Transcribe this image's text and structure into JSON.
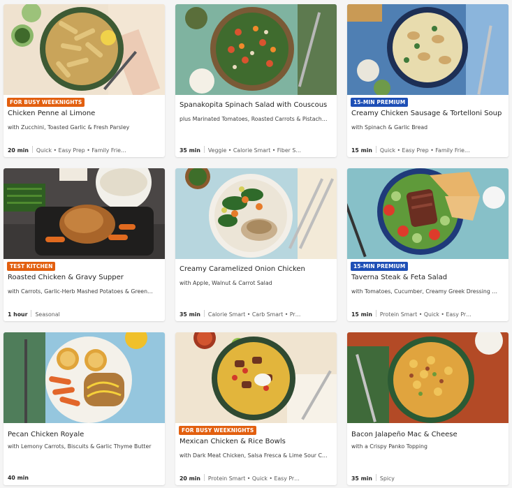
{
  "recipes": [
    {
      "title": "Chicken Penne al Limone",
      "badge": "FOR BUSY WEEKNIGHTS",
      "badge_color": "#e25f0f",
      "subtitle": "with Zucchini, Toasted Garlic & Fresh Parsley",
      "time": "20 min",
      "tags": "Quick • Easy Prep • Family Frie…"
    },
    {
      "title": "Spanakopita Spinach Salad with Couscous",
      "badge": "",
      "subtitle": "plus Marinated Tomatoes, Roasted Carrots & Pistach…",
      "time": "35 min",
      "tags": "Veggie • Calorie Smart • Fiber S…"
    },
    {
      "title": "Creamy Chicken Sausage & Tortelloni Soup",
      "badge": "15-MIN PREMIUM",
      "badge_color": "#1e4fb6",
      "subtitle": "with Spinach & Garlic Bread",
      "time": "15 min",
      "tags": "Quick • Easy Prep • Family Frie…"
    },
    {
      "title": "Roasted Chicken & Gravy Supper",
      "badge": "TEST KITCHEN",
      "badge_color": "#e25f0f",
      "subtitle": "with Carrots, Garlic-Herb Mashed Potatoes & Green…",
      "time": "1 hour",
      "tags": "Seasonal"
    },
    {
      "title": "Creamy Caramelized Onion Chicken",
      "badge": "",
      "subtitle": "with Apple, Walnut & Carrot Salad",
      "time": "35 min",
      "tags": "Calorie Smart • Carb Smart • Pr…"
    },
    {
      "title": "Taverna Steak & Feta Salad",
      "badge": "15-MIN PREMIUM",
      "badge_color": "#1e4fb6",
      "subtitle": "with Tomatoes, Cucumber, Creamy Greek Dressing …",
      "time": "15 min",
      "tags": "Protein Smart • Quick • Easy Pr…"
    },
    {
      "title": "Pecan Chicken Royale",
      "badge": "",
      "subtitle": "with Lemony Carrots, Biscuits & Garlic Thyme Butter",
      "time": "40 min",
      "tags": ""
    },
    {
      "title": "Mexican Chicken & Rice Bowls",
      "badge": "FOR BUSY WEEKNIGHTS",
      "badge_color": "#e25f0f",
      "subtitle": "with Dark Meat Chicken, Salsa Fresca & Lime Sour C…",
      "time": "20 min",
      "tags": "Protein Smart • Quick • Easy Pr…"
    },
    {
      "title": "Bacon Jalapeño Mac & Cheese",
      "badge": "",
      "subtitle": "with a Crispy Panko Topping",
      "time": "35 min",
      "tags": "Spicy"
    }
  ]
}
